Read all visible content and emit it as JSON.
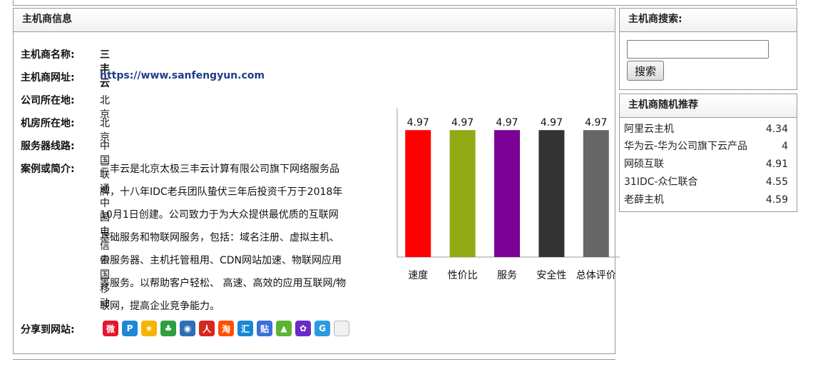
{
  "host_info": {
    "title": "主机商信息",
    "name_label": "主机商名称:",
    "name_value": "三丰云",
    "url_label": "主机商网址:",
    "url_value": "https://www.sanfengyun.com",
    "company_label": "公司所在地:",
    "company_value": "北京",
    "datacenter_label": "机房所在地:",
    "datacenter_value": "北京",
    "lines_label": "服务器线路:",
    "lines_value": "中国联通 中国电信 中国移动",
    "intro_label": "案例或简介:",
    "intro_lines": [
      "三丰云是北京太极三丰云计算有限公司旗下网络服务品",
      "牌，十八年IDC老兵团队蛰伏三年后投资千万于2018年",
      "10月1日创建。公司致力于为大众提供最优质的互联网",
      "基础服务和物联网服务，包括：域名注册、虚拟主机、",
      "云服务器、主机托管租用、CDN网站加速、物联网应用",
      "等服务。以帮助客户轻松、 高速、高效的应用互联网/物",
      "联网，提高企业竞争能力。"
    ],
    "share_label": "分享到网站:",
    "share_icons": [
      {
        "icon": "weibo-icon",
        "glyph": "微",
        "color": "#e6162d"
      },
      {
        "icon": "qzone-icon",
        "glyph": "P",
        "color": "#1e88d6"
      },
      {
        "icon": "qqzone-star-icon",
        "glyph": "★",
        "color": "#f5b400"
      },
      {
        "icon": "clover-icon",
        "glyph": "♣",
        "color": "#2e9e3e"
      },
      {
        "icon": "tencent-weibo-icon",
        "glyph": "◉",
        "color": "#2d6fb5"
      },
      {
        "icon": "renren-icon",
        "glyph": "人",
        "color": "#d7261f"
      },
      {
        "icon": "taobao-icon",
        "glyph": "淘",
        "color": "#ff5000"
      },
      {
        "icon": "huaban-icon",
        "glyph": "汇",
        "color": "#1787d3"
      },
      {
        "icon": "tieba-icon",
        "glyph": "贴",
        "color": "#3a6fd8"
      },
      {
        "icon": "landscape-icon",
        "glyph": "▲",
        "color": "#5cb531"
      },
      {
        "icon": "baidu-paw-icon",
        "glyph": "✿",
        "color": "#6a2cc8"
      },
      {
        "icon": "google-icon",
        "glyph": "G",
        "color": "#2a9be0"
      },
      {
        "icon": "copy-icon",
        "glyph": "",
        "color": "#d8d8d8"
      }
    ]
  },
  "chart_data": {
    "type": "bar",
    "categories": [
      "速度",
      "性价比",
      "服务",
      "安全性",
      "总体评价"
    ],
    "values": [
      4.97,
      4.97,
      4.97,
      4.97,
      4.97
    ],
    "value_labels": [
      "4.97",
      "4.97",
      "4.97",
      "4.97",
      "4.97"
    ],
    "colors": [
      "#ff0000",
      "#90aa14",
      "#7b0096",
      "#333333",
      "#666666"
    ],
    "ylim": [
      0,
      5.2
    ],
    "grid": false,
    "title": "",
    "xlabel": "",
    "ylabel": ""
  },
  "search": {
    "title": "主机商搜索:",
    "input_value": "",
    "button_label": "搜索"
  },
  "recommend": {
    "title": "主机商随机推荐",
    "items": [
      {
        "name": "阿里云主机",
        "score": "4.34"
      },
      {
        "name": "华为云-华为公司旗下云产品",
        "score": "4"
      },
      {
        "name": "网硕互联",
        "score": "4.91"
      },
      {
        "name": "31IDC-众仁联合",
        "score": "4.55"
      },
      {
        "name": "老薛主机",
        "score": "4.59"
      }
    ]
  }
}
